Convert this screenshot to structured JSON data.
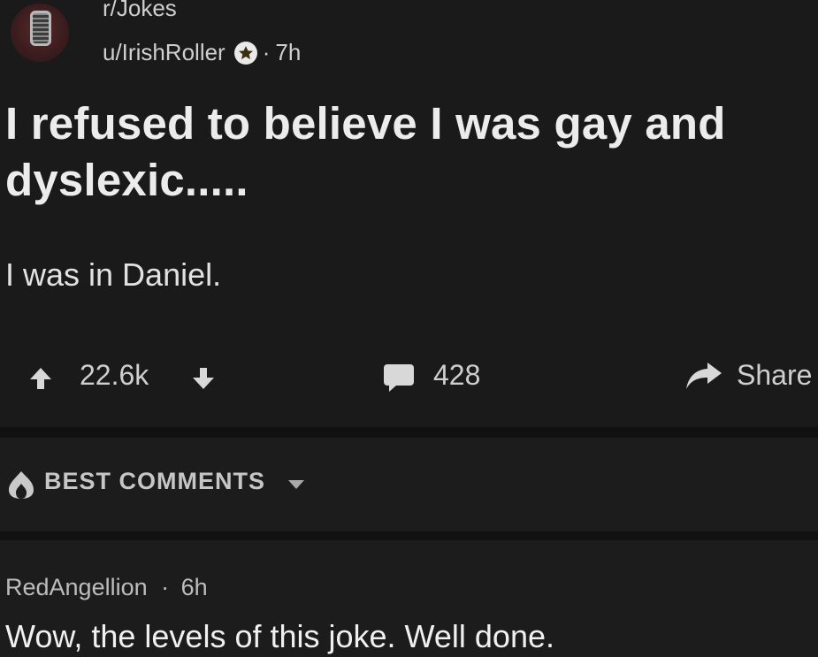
{
  "post": {
    "subreddit": "r/Jokes",
    "author": "u/IrishRoller",
    "separator": "·",
    "age": "7h",
    "title": "I refused to believe I was gay and dyslexic.....",
    "body": "I was in Daniel.",
    "score": "22.6k",
    "comment_count": "428",
    "share_label": "Share"
  },
  "sort": {
    "label": "BEST COMMENTS"
  },
  "comments": [
    {
      "author": "RedAngellion",
      "separator": "·",
      "age": "6h",
      "body": "Wow, the levels of this joke. Well done."
    }
  ],
  "colors": {
    "background": "#1a1a1b",
    "text": "#d7dadc",
    "muted": "#cfcfcf"
  },
  "icons": [
    "subreddit-avatar",
    "award-icon",
    "upvote-icon",
    "downvote-icon",
    "comment-icon",
    "share-icon",
    "flame-icon",
    "chevron-down-icon"
  ]
}
